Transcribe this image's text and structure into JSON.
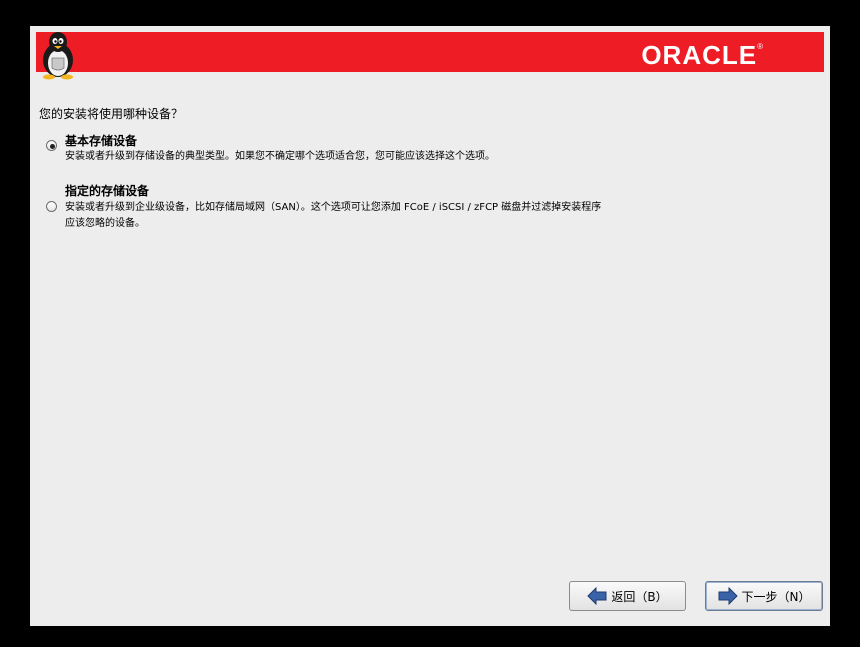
{
  "banner": {
    "brand": "ORACLE",
    "trademark": "®",
    "color": "#ee1c25"
  },
  "question": "您的安装将使用哪种设备？",
  "options": [
    {
      "title": "基本存储设备",
      "description": "安装或者升级到存储设备的典型类型。如果您不确定哪个选项适合您，您可能应该选择这个选项。",
      "selected": true
    },
    {
      "title": "指定的存储设备",
      "description_line1": "安装或者升级到企业级设备，比如存储局域网（SAN）。这个选项可让您添加 FCoE / iSCSI / zFCP 磁盘并过滤掉安装程序",
      "description_line2": "应该忽略的设备。",
      "selected": false
    }
  ],
  "buttons": {
    "back_label": "返回（B）",
    "back_icon": "arrow-left-icon",
    "next_label": "下一步（N）",
    "next_icon": "arrow-right-icon"
  },
  "icons": {
    "arrow_color": "#3a62a8"
  }
}
